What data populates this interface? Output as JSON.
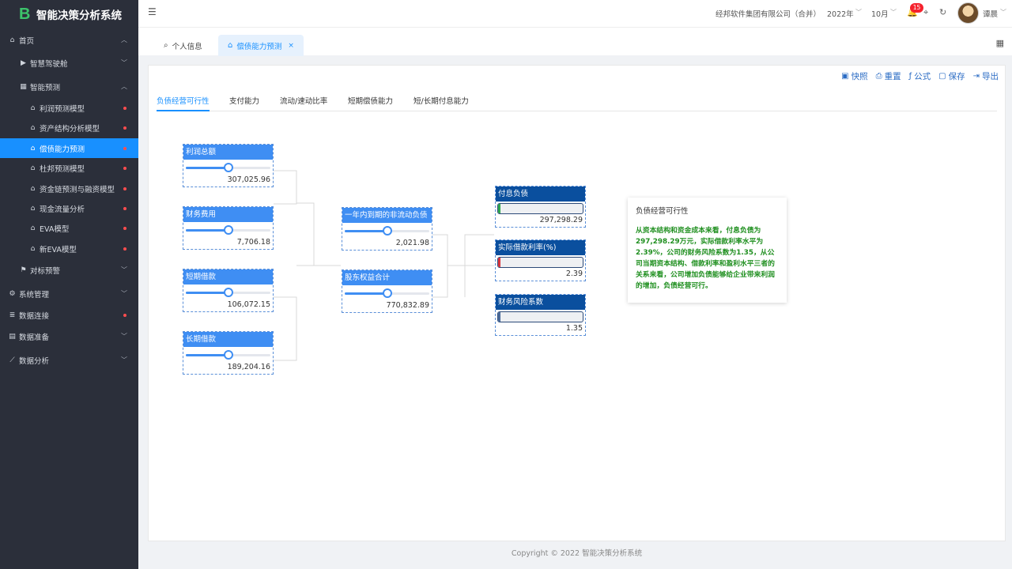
{
  "app": {
    "logo_letter": "B",
    "title": "智能决策分析系统"
  },
  "sidebar": {
    "items": [
      {
        "label": "首页",
        "icon": "home-icon",
        "glyph": "⌂",
        "chevron": "︿",
        "level": 0
      },
      {
        "label": "智慧驾驶舱",
        "icon": "play-icon",
        "glyph": "▶",
        "chevron": "﹀",
        "level": 1
      },
      {
        "label": "智能预测",
        "icon": "grid-icon",
        "glyph": "▦",
        "chevron": "︿",
        "level": 1
      },
      {
        "label": "利润预测模型",
        "icon": "home-icon",
        "glyph": "⌂",
        "dot": true,
        "level": 2
      },
      {
        "label": "资产结构分析模型",
        "icon": "home-icon",
        "glyph": "⌂",
        "dot": true,
        "level": 2
      },
      {
        "label": "偿债能力预测",
        "icon": "home-icon",
        "glyph": "⌂",
        "dot": true,
        "level": 2,
        "active": true
      },
      {
        "label": "杜邦预测模型",
        "icon": "home-icon",
        "glyph": "⌂",
        "dot": true,
        "level": 2
      },
      {
        "label": "资金链预测与融资模型",
        "icon": "home-icon",
        "glyph": "⌂",
        "dot": true,
        "level": 2
      },
      {
        "label": "现金流量分析",
        "icon": "home-icon",
        "glyph": "⌂",
        "dot": true,
        "level": 2
      },
      {
        "label": "EVA模型",
        "icon": "home-icon",
        "glyph": "⌂",
        "dot": true,
        "level": 2
      },
      {
        "label": "新EVA模型",
        "icon": "home-icon",
        "glyph": "⌂",
        "dot": true,
        "level": 2
      },
      {
        "label": "对标预警",
        "icon": "flag-icon",
        "glyph": "⚑",
        "chevron": "﹀",
        "level": 1
      },
      {
        "label": "系统管理",
        "icon": "gear-icon",
        "glyph": "⚙",
        "chevron": "﹀",
        "level": 0
      },
      {
        "label": "数据连接",
        "icon": "database-icon",
        "glyph": "≣",
        "dot": true,
        "level": 0
      },
      {
        "label": "数据准备",
        "icon": "chart-icon",
        "glyph": "▤",
        "chevron": "﹀",
        "level": 0
      },
      {
        "label": "数据分析",
        "icon": "line-chart-icon",
        "glyph": "⟋",
        "chevron": "﹀",
        "level": 0
      }
    ]
  },
  "header": {
    "fold_glyph": "☰",
    "company": "经邦软件集团有限公司（合并）",
    "year": "2022年",
    "month": "10月",
    "notification_count": "15",
    "username": "谭晨"
  },
  "tabs": [
    {
      "label": "个人信息",
      "glyph": "⌕"
    },
    {
      "label": "偿债能力预测",
      "glyph": "⌂",
      "close": "×"
    }
  ],
  "toolbar": [
    {
      "label": "快照",
      "glyph": "▣"
    },
    {
      "label": "重置",
      "glyph": "⎙"
    },
    {
      "label": "公式",
      "glyph": "ƒ"
    },
    {
      "label": "保存",
      "glyph": "▢"
    },
    {
      "label": "导出",
      "glyph": "⇥"
    }
  ],
  "sub_tabs": [
    "负债经营可行性",
    "支付能力",
    "流动/速动比率",
    "短期偿债能力",
    "短/长期付息能力"
  ],
  "inputs": [
    {
      "title": "利润总额",
      "value": "307,025.96",
      "slider": 0.5
    },
    {
      "title": "财务费用",
      "value": "7,706.18",
      "slider": 0.5
    },
    {
      "title": "短期借款",
      "value": "106,072.15",
      "slider": 0.5
    },
    {
      "title": "长期借款",
      "value": "189,204.16",
      "slider": 0.5
    }
  ],
  "middle": [
    {
      "title": "一年内到期的非流动负债",
      "value": "2,021.98",
      "slider": 0.5
    },
    {
      "title": "股东权益合计",
      "value": "770,832.89",
      "slider": 0.5
    }
  ],
  "outputs": [
    {
      "title": "付息负债",
      "value": "297,298.29",
      "bar": 0.03,
      "bar_color": "#2fa84f"
    },
    {
      "title": "实际借款利率(%)",
      "value": "2.39",
      "bar": 0.02,
      "bar_color": "#d9363e"
    },
    {
      "title": "财务风险系数",
      "value": "1.35",
      "bar": 0.01,
      "bar_color": "#4a6a9a"
    }
  ],
  "analysis": {
    "title": "负债经营可行性",
    "body": "从资本结构和资金成本来看，付息负债为297,298.29万元，实际借款利率水平为2.39%，公司的财务风险系数为1.35，从公司当期资本结构、借款利率和盈利水平三者的关系来看，公司增加负债能够给企业带来利润的增加，负债经营可行。"
  },
  "footer": "Copyright © 2022 智能决策分析系统"
}
